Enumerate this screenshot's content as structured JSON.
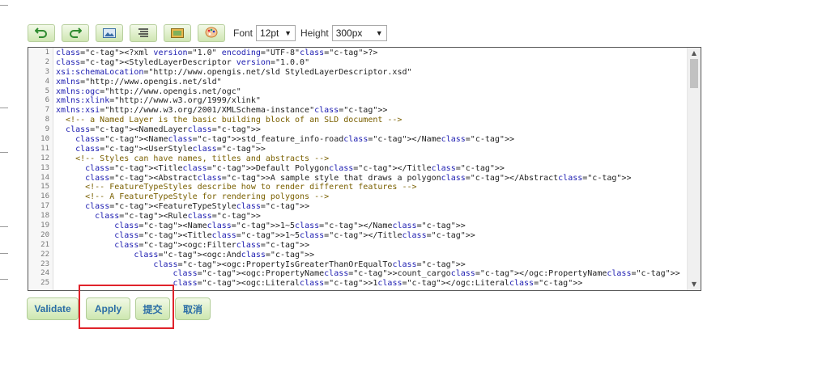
{
  "toolbar": {
    "buttons": [
      {
        "icon": "undo-icon",
        "color": "#2e8b2e"
      },
      {
        "icon": "redo-icon",
        "color": "#2e8b2e"
      },
      {
        "icon": "image-icon",
        "color": "#3a6ea5"
      },
      {
        "icon": "format-lines-icon",
        "color": "#333333"
      },
      {
        "icon": "picture-frame-icon",
        "color": "#5a8a2a"
      },
      {
        "icon": "palette-icon",
        "color": "#c8782a"
      }
    ],
    "font_label": "Font",
    "font_value": "12pt",
    "height_label": "Height",
    "height_value": "300px"
  },
  "editor": {
    "lines": [
      {
        "n": "1",
        "text": "<?xml version=\"1.0\" encoding=\"UTF-8\"?>"
      },
      {
        "n": "2",
        "text": "<StyledLayerDescriptor version=\"1.0.0\""
      },
      {
        "n": "3",
        "text": "xsi:schemaLocation=\"http://www.opengis.net/sld StyledLayerDescriptor.xsd\""
      },
      {
        "n": "4",
        "text": "xmlns=\"http://www.opengis.net/sld\""
      },
      {
        "n": "5",
        "text": "xmlns:ogc=\"http://www.opengis.net/ogc\""
      },
      {
        "n": "6",
        "text": "xmlns:xlink=\"http://www.w3.org/1999/xlink\""
      },
      {
        "n": "7",
        "text": "xmlns:xsi=\"http://www.w3.org/2001/XMLSchema-instance\">"
      },
      {
        "n": "8",
        "text": "  <!-- a Named Layer is the basic building block of an SLD document -->"
      },
      {
        "n": "9",
        "text": "  <NamedLayer>"
      },
      {
        "n": "10",
        "text": "    <Name>std_feature_info-road</Name>"
      },
      {
        "n": "11",
        "text": "    <UserStyle>"
      },
      {
        "n": "12",
        "text": "    <!-- Styles can have names, titles and abstracts -->"
      },
      {
        "n": "13",
        "text": "      <Title>Default Polygon</Title>"
      },
      {
        "n": "14",
        "text": "      <Abstract>A sample style that draws a polygon</Abstract>"
      },
      {
        "n": "15",
        "text": "      <!-- FeatureTypeStyles describe how to render different features -->"
      },
      {
        "n": "16",
        "text": "      <!-- A FeatureTypeStyle for rendering polygons -->"
      },
      {
        "n": "17",
        "text": "      <FeatureTypeStyle>"
      },
      {
        "n": "18",
        "text": "        <Rule>"
      },
      {
        "n": "19",
        "text": "            <Name>1~5</Name>"
      },
      {
        "n": "20",
        "text": "            <Title>1~5</Title>"
      },
      {
        "n": "21",
        "text": "            <ogc:Filter>"
      },
      {
        "n": "22",
        "text": "                <ogc:And>"
      },
      {
        "n": "23",
        "text": "                    <ogc:PropertyIsGreaterThanOrEqualTo>"
      },
      {
        "n": "24",
        "text": "                        <ogc:PropertyName>count_cargo</ogc:PropertyName>"
      },
      {
        "n": "25",
        "text": "                        <ogc:Literal>1</ogc:Literal>"
      }
    ]
  },
  "actions": {
    "validate": "Validate",
    "apply": "Apply",
    "submit": "提交",
    "cancel": "取消"
  },
  "colors": {
    "highlight_box": "#e0232b",
    "button_text": "#2b6da6",
    "button_bg": "#d6eabf"
  }
}
